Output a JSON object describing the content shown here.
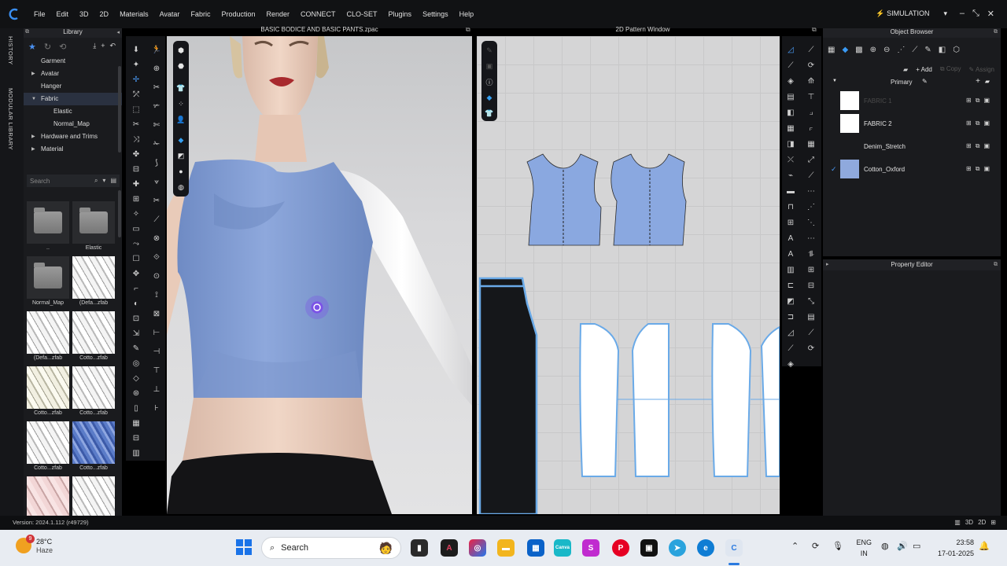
{
  "menubar": {
    "items": [
      "File",
      "Edit",
      "3D",
      "2D",
      "Materials",
      "Avatar",
      "Fabric",
      "Production",
      "Render",
      "CONNECT",
      "CLO-SET",
      "Plugins",
      "Settings",
      "Help"
    ],
    "mode": "SIMULATION"
  },
  "sidetabs": {
    "history": "HISTORY",
    "modular": "MODULAR LIBRARY"
  },
  "library": {
    "title": "Library",
    "tree": [
      {
        "label": "Garment",
        "indent": 0,
        "arrow": ""
      },
      {
        "label": "Avatar",
        "indent": 1,
        "arrow": "▶"
      },
      {
        "label": "Hanger",
        "indent": 1,
        "arrow": ""
      },
      {
        "label": "Fabric",
        "indent": 1,
        "arrow": "▼",
        "selected": true
      },
      {
        "label": "Elastic",
        "indent": 2,
        "arrow": ""
      },
      {
        "label": "Normal_Map",
        "indent": 2,
        "arrow": ""
      },
      {
        "label": "Hardware and Trims",
        "indent": 1,
        "arrow": "▶"
      },
      {
        "label": "Material",
        "indent": 1,
        "arrow": "▶"
      }
    ],
    "search_placeholder": "Search",
    "thumbs": [
      {
        "label": "..",
        "kind": "folder"
      },
      {
        "label": "Elastic",
        "kind": "folder"
      },
      {
        "label": "Normal_Map",
        "kind": "folder"
      },
      {
        "label": "(Defa...zfab",
        "kind": "white"
      },
      {
        "label": "(Defa...zfab",
        "kind": "white"
      },
      {
        "label": "Cotto...zfab",
        "kind": "white"
      },
      {
        "label": "Cotto...zfab",
        "kind": "cream"
      },
      {
        "label": "Cotto...zfab",
        "kind": "white"
      },
      {
        "label": "Cotto...zfab",
        "kind": "white"
      },
      {
        "label": "Cotto...zfab",
        "kind": "blue"
      },
      {
        "label": "",
        "kind": "pink"
      },
      {
        "label": "",
        "kind": "white"
      }
    ]
  },
  "view3d": {
    "title": "BASIC BODICE AND BASIC PANTS.zpac"
  },
  "view2d": {
    "title": "2D Pattern Window"
  },
  "object_browser": {
    "title": "Object Browser",
    "add_label": "Add",
    "copy_label": "Copy",
    "assign_label": "Assign",
    "group_label": "Primary",
    "fabrics": [
      {
        "name": "FABRIC 1",
        "color": "#ffffff",
        "dim": true,
        "checked": false
      },
      {
        "name": "FABRIC 2",
        "color": "#ffffff",
        "dim": false,
        "checked": false
      },
      {
        "name": "Denim_Stretch",
        "color": "",
        "dim": false,
        "checked": false
      },
      {
        "name": "Cotton_Oxford",
        "color": "#8fa9dd",
        "dim": false,
        "checked": true
      }
    ]
  },
  "property_editor": {
    "title": "Property Editor"
  },
  "status": {
    "version": "Version: 2024.1.112 (r49729)"
  },
  "taskbar": {
    "temp": "28°C",
    "weather": "Haze",
    "weather_badge": "9",
    "search": "Search",
    "lang1": "ENG",
    "lang2": "IN",
    "time": "23:58",
    "date": "17-01-2025"
  },
  "colors": {
    "accent": "#3a9af4",
    "fabric_blue": "#8fa9dd",
    "pattern_blue": "#8aa8e0"
  }
}
